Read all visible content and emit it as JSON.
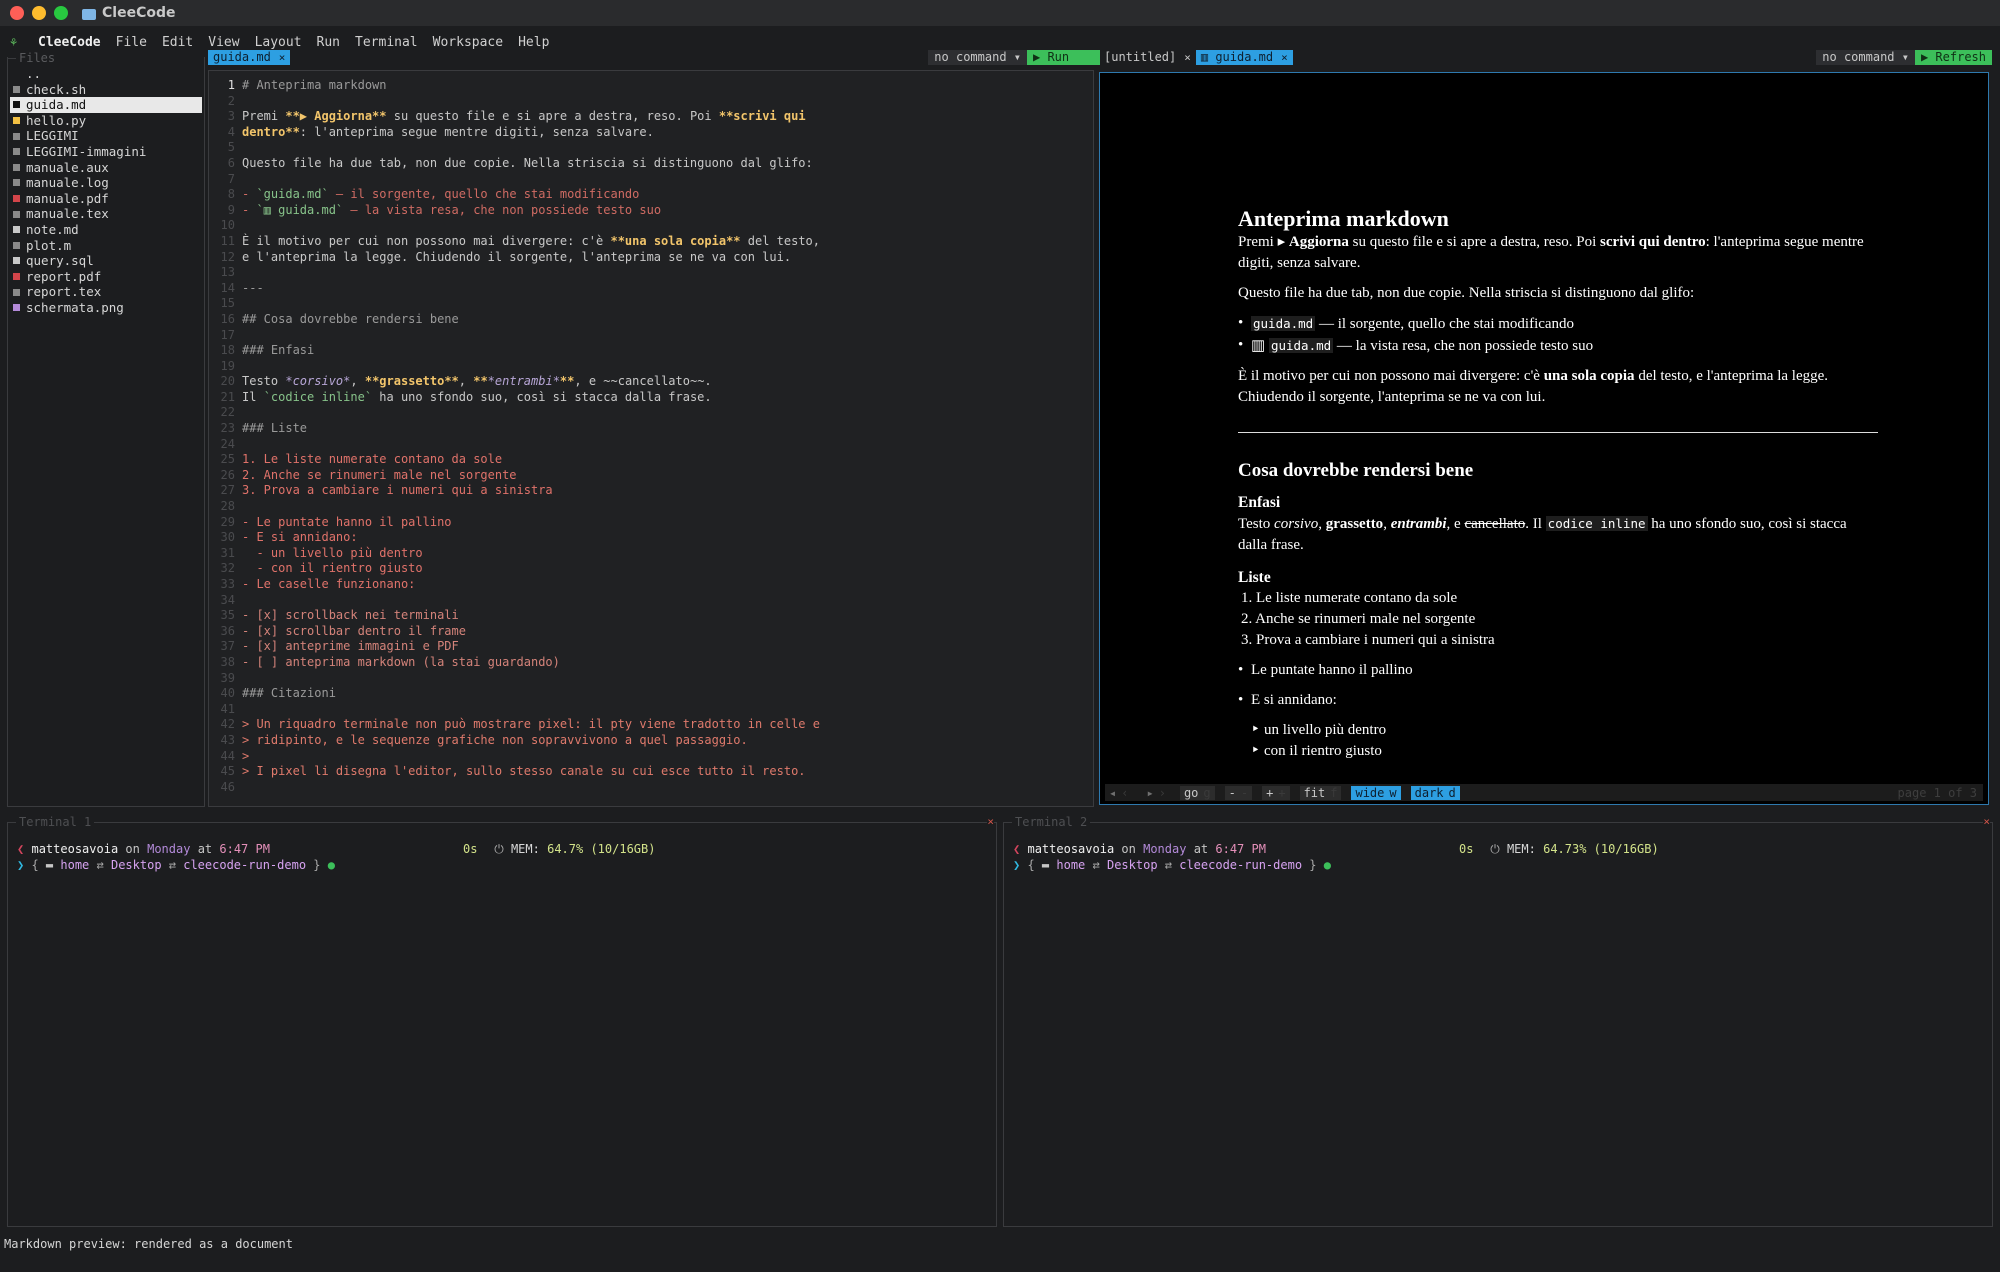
{
  "window": {
    "title": "CleeCode"
  },
  "menu": {
    "brand": "CleeCode",
    "items": [
      "File",
      "Edit",
      "View",
      "Layout",
      "Run",
      "Terminal",
      "Workspace",
      "Help"
    ]
  },
  "explorer": {
    "title": "Files",
    "items": [
      {
        "name": "..",
        "icon": "",
        "color": ""
      },
      {
        "name": "check.sh",
        "icon": "shell-file-icon",
        "color": "#8a8a8a"
      },
      {
        "name": "guida.md",
        "icon": "markdown-file-icon",
        "color": "#111111",
        "active": true
      },
      {
        "name": "hello.py",
        "icon": "python-file-icon",
        "color": "#f2c043"
      },
      {
        "name": "LEGGIMI",
        "icon": "text-file-icon",
        "color": "#8a8a8a"
      },
      {
        "name": "LEGGIMI-immagini",
        "icon": "text-file-icon",
        "color": "#8a8a8a"
      },
      {
        "name": "manuale.aux",
        "icon": "text-file-icon",
        "color": "#8a8a8a"
      },
      {
        "name": "manuale.log",
        "icon": "text-file-icon",
        "color": "#8a8a8a"
      },
      {
        "name": "manuale.pdf",
        "icon": "pdf-file-icon",
        "color": "#d3454a"
      },
      {
        "name": "manuale.tex",
        "icon": "text-file-icon",
        "color": "#8a8a8a"
      },
      {
        "name": "note.md",
        "icon": "markdown-file-icon",
        "color": "#c8c8c8"
      },
      {
        "name": "plot.m",
        "icon": "text-file-icon",
        "color": "#8a8a8a"
      },
      {
        "name": "query.sql",
        "icon": "database-file-icon",
        "color": "#c8c8c8"
      },
      {
        "name": "report.pdf",
        "icon": "pdf-file-icon",
        "color": "#d3454a"
      },
      {
        "name": "report.tex",
        "icon": "text-file-icon",
        "color": "#8a8a8a"
      },
      {
        "name": "schermata.png",
        "icon": "image-file-icon",
        "color": "#b38ad9"
      }
    ]
  },
  "editor": {
    "tab": "guida.md",
    "toolbar": {
      "command": "no command ▾",
      "run": "▶ Run"
    }
  },
  "preview_pane": {
    "tabs": [
      {
        "label": "[untitled]"
      },
      {
        "label": "▥ guida.md",
        "active": true
      }
    ],
    "toolbar": {
      "command": "no command ▾",
      "refresh": "▶ Refresh"
    },
    "controls": {
      "prev": "◂",
      "prev_key": "‹",
      "next": "▸",
      "next_key": "›",
      "go": "go",
      "go_key": "g",
      "zoom_out": "-",
      "zoom_out_key": "-",
      "zoom_in": "+",
      "zoom_in_key": "+",
      "fit": "fit",
      "fit_key": "f",
      "wide": "wide",
      "wide_key": "w",
      "dark": "dark",
      "dark_key": "d",
      "page": "page 1 of 3"
    },
    "doc": {
      "h1": "Anteprima markdown",
      "p1_a": "Premi ▸ ",
      "p1_b": "Aggiorna",
      "p1_c": " su questo file e si apre a destra, reso. Poi ",
      "p1_d": "scrivi qui dentro",
      "p1_e": ": l'anteprima segue mentre digiti, senza salvare.",
      "p2": "Questo file ha due tab, non due copie. Nella striscia si distinguono dal glifo:",
      "li1_code": "guida.md",
      "li1_text": " — il sorgente, quello che stai modificando",
      "li2_prefix": "▥ ",
      "li2_code": "guida.md",
      "li2_text": " — la vista resa, che non possiede testo suo",
      "p3_a": "È il motivo per cui non possono mai divergere: c'è ",
      "p3_b": "una sola copia",
      "p3_c": " del testo, e l'anteprima la legge. Chiudendo il sorgente, l'anteprima se ne va con lui.",
      "h2": "Cosa dovrebbe rendersi bene",
      "h3_1": "Enfasi",
      "p4_a": "Testo ",
      "p4_i": "corsivo",
      "p4_b_sep": ", ",
      "p4_b": "grassetto",
      "p4_bi_sep": ", ",
      "p4_bi": "entrambi",
      "p4_s_sep": ", e ",
      "p4_s": "cancellato",
      "p4_c": ". Il ",
      "p4_code": "codice inline",
      "p4_d": " ha uno sfondo suo, così si stacca dalla frase.",
      "h3_2": "Liste",
      "ol": [
        "1.  Le liste numerate contano da sole",
        "2.  Anche se rinumeri male nel sorgente",
        "3.  Prova a cambiare i numeri qui a sinistra"
      ],
      "ul1": "Le puntate hanno il pallino",
      "ul2": "E si annidano:",
      "sub1": "un livello più dentro",
      "sub2": "con il rientro giusto"
    }
  },
  "terminals": [
    {
      "title": "Terminal 1",
      "user": "matteosavoia",
      "on": "on",
      "day": "Monday",
      "at": "at",
      "time": "6:47 PM",
      "secs": "0s",
      "mem_label": "MEM:",
      "mem": "64.7% (10/16GB)",
      "path": [
        "home",
        "Desktop",
        "cleecode-run-demo"
      ]
    },
    {
      "title": "Terminal 2",
      "user": "matteosavoia",
      "on": "on",
      "day": "Monday",
      "at": "at",
      "time": "6:47 PM",
      "secs": "0s",
      "mem_label": "MEM:",
      "mem": "64.73% (10/16GB)",
      "path": [
        "home",
        "Desktop",
        "cleecode-run-demo"
      ]
    }
  ],
  "status": {
    "message": "Markdown preview: rendered as a document"
  },
  "code_lines": [
    [
      {
        "c": "c-h",
        "t": "# Anteprima markdown"
      }
    ],
    [],
    [
      {
        "c": "c-t",
        "t": "Premi "
      },
      {
        "c": "c-b",
        "t": "**▶ Aggiorna**"
      },
      {
        "c": "c-t",
        "t": " su questo file e si apre a destra, reso. Poi "
      },
      {
        "c": "c-b",
        "t": "**scrivi qui"
      }
    ],
    [
      {
        "c": "c-b",
        "t": "dentro**"
      },
      {
        "c": "c-t",
        "t": ": l'anteprima segue mentre digiti, senza salvare."
      }
    ],
    [],
    [
      {
        "c": "c-t",
        "t": "Questo file ha due tab, non due copie. Nella striscia si distinguono dal glifo:"
      }
    ],
    [],
    [
      {
        "c": "c-bullet",
        "t": "- "
      },
      {
        "c": "c-code",
        "t": "`guida.md`"
      },
      {
        "c": "c-bullet",
        "t": " — il sorgente, quello che stai modificando"
      }
    ],
    [
      {
        "c": "c-bullet",
        "t": "- "
      },
      {
        "c": "c-code",
        "t": "`▥ guida.md`"
      },
      {
        "c": "c-bullet",
        "t": " — la vista resa, che non possiede testo suo"
      }
    ],
    [],
    [
      {
        "c": "c-t",
        "t": "È il motivo per cui non possono mai divergere: c'è "
      },
      {
        "c": "c-b",
        "t": "**una sola copia**"
      },
      {
        "c": "c-t",
        "t": " del testo,"
      }
    ],
    [
      {
        "c": "c-t",
        "t": "e l'anteprima la legge. Chiudendo il sorgente, l'anteprima se ne va con lui."
      }
    ],
    [],
    [
      {
        "c": "c-h",
        "t": "---"
      }
    ],
    [],
    [
      {
        "c": "c-h",
        "t": "## Cosa dovrebbe rendersi bene"
      }
    ],
    [],
    [
      {
        "c": "c-h",
        "t": "### Enfasi"
      }
    ],
    [],
    [
      {
        "c": "c-t",
        "t": "Testo "
      },
      {
        "c": "c-i",
        "t": "*corsivo*"
      },
      {
        "c": "c-t",
        "t": ", "
      },
      {
        "c": "c-b",
        "t": "**grassetto**"
      },
      {
        "c": "c-t",
        "t": ", "
      },
      {
        "c": "c-b",
        "t": "**"
      },
      {
        "c": "c-i",
        "t": "*entrambi*"
      },
      {
        "c": "c-b",
        "t": "**"
      },
      {
        "c": "c-t",
        "t": ", e ~~cancellato~~."
      }
    ],
    [
      {
        "c": "c-t",
        "t": "Il "
      },
      {
        "c": "c-code",
        "t": "`codice inline`"
      },
      {
        "c": "c-t",
        "t": " ha uno sfondo suo, così si stacca dalla frase."
      }
    ],
    [],
    [
      {
        "c": "c-h",
        "t": "### Liste"
      }
    ],
    [],
    [
      {
        "c": "c-list",
        "t": "1. Le liste numerate contano da sole"
      }
    ],
    [
      {
        "c": "c-list",
        "t": "2. Anche se rinumeri male nel sorgente"
      }
    ],
    [
      {
        "c": "c-list",
        "t": "3. Prova a cambiare i numeri qui a sinistra"
      }
    ],
    [],
    [
      {
        "c": "c-list",
        "t": "- Le puntate hanno il pallino"
      }
    ],
    [
      {
        "c": "c-list",
        "t": "- E si annidano:"
      }
    ],
    [
      {
        "c": "c-list",
        "t": "  - un livello più dentro"
      }
    ],
    [
      {
        "c": "c-list",
        "t": "  - con il rientro giusto"
      }
    ],
    [
      {
        "c": "c-list",
        "t": "- Le caselle funzionano:"
      }
    ],
    [],
    [
      {
        "c": "c-task",
        "t": "- [x] scrollback nei terminali"
      }
    ],
    [
      {
        "c": "c-task",
        "t": "- [x] scrollbar dentro il frame"
      }
    ],
    [
      {
        "c": "c-task",
        "t": "- [x] anteprime immagini e PDF"
      }
    ],
    [
      {
        "c": "c-task",
        "t": "- [ ] anteprima markdown (la stai guardando)"
      }
    ],
    [],
    [
      {
        "c": "c-h",
        "t": "### Citazioni"
      }
    ],
    [],
    [
      {
        "c": "c-q",
        "t": "> Un riquadro terminale non può mostrare pixel: il pty viene tradotto in celle e"
      }
    ],
    [
      {
        "c": "c-q",
        "t": "> ridipinto, e le sequenze grafiche non sopravvivono a quel passaggio."
      }
    ],
    [
      {
        "c": "c-q",
        "t": ">"
      }
    ],
    [
      {
        "c": "c-q",
        "t": "> I pixel li disegna l'editor, sullo stesso canale su cui esce tutto il resto."
      }
    ],
    []
  ]
}
